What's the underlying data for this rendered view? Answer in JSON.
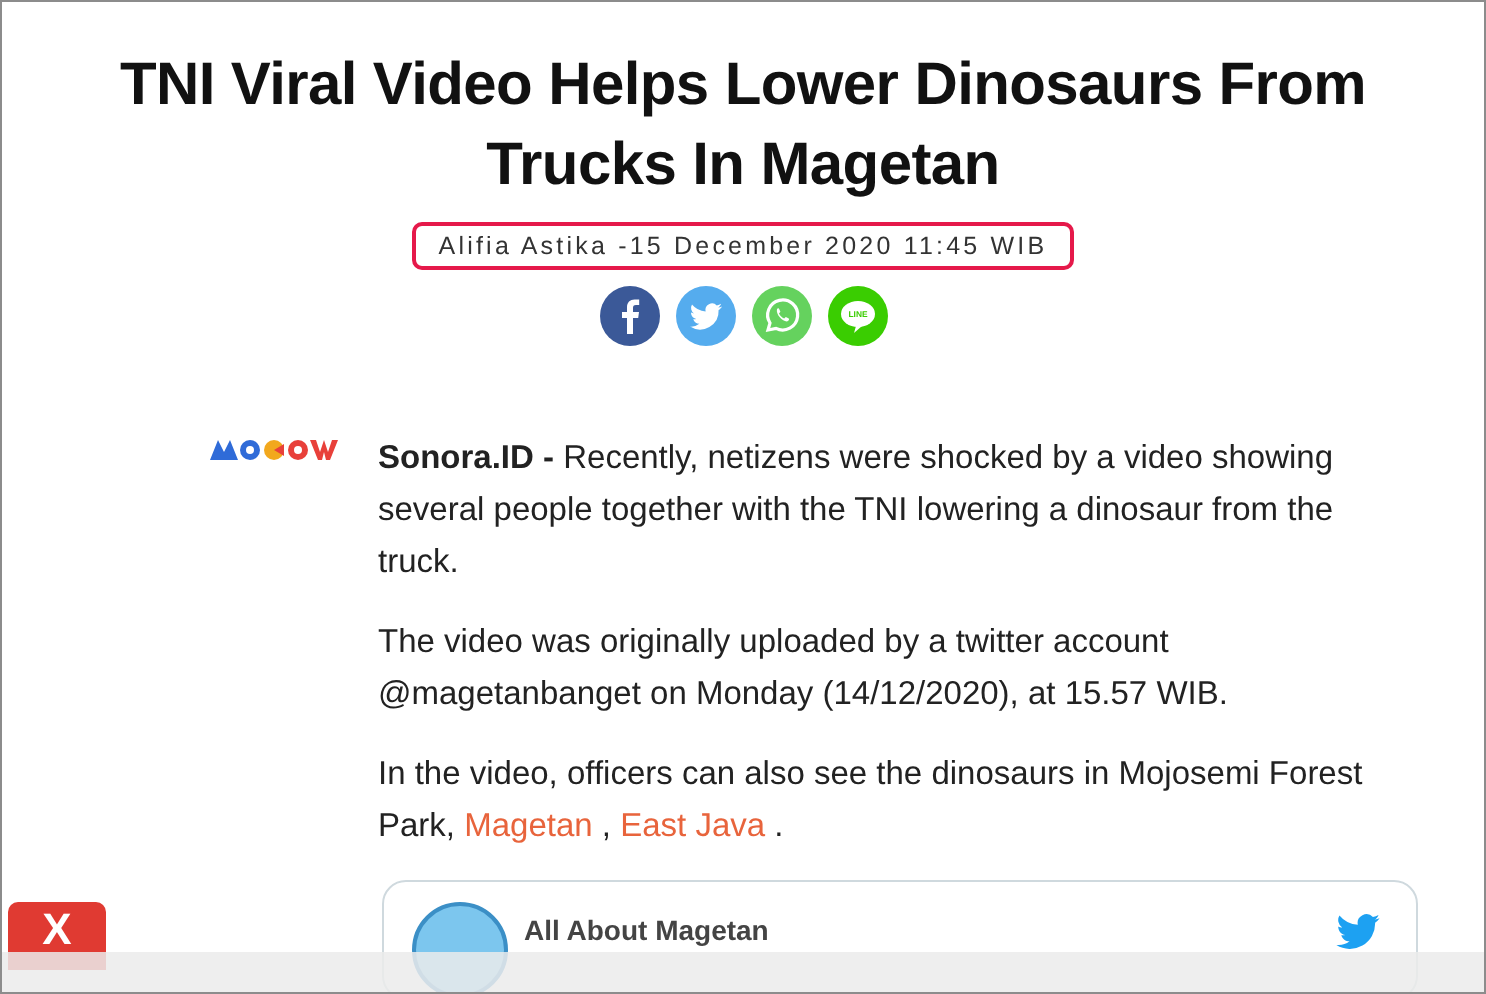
{
  "article": {
    "title": "TNI Viral Video Helps Lower Dinosaurs From Trucks In Magetan",
    "byline": "Alifia Astika -15 December 2020 11:45 WIB",
    "share": [
      {
        "kind": "facebook"
      },
      {
        "kind": "twitter"
      },
      {
        "kind": "whatsapp"
      },
      {
        "kind": "line",
        "label": "LINE"
      }
    ],
    "paragraphs": [
      {
        "parts": [
          {
            "kind": "text",
            "text": "**Sonora.ID -**  Recently, netizens were shocked by a video showing several people together with the TNI lowering a dinosaur from the truck."
          }
        ]
      },
      {
        "parts": [
          {
            "kind": "text",
            "text": "The video was originally uploaded by a twitter account @magetanbanget on Monday (14/12/2020), at 15.57 WIB."
          }
        ]
      },
      {
        "parts": [
          {
            "kind": "text",
            "text": "In the video, officers can also see the dinosaurs in Mojosemi Forest Park, "
          },
          {
            "kind": "link",
            "text": "Magetan"
          },
          {
            "kind": "text",
            "text": " , "
          },
          {
            "kind": "link",
            "text": "East Java"
          },
          {
            "kind": "text",
            "text": " ."
          }
        ]
      }
    ],
    "tweet": {
      "account": "All About Magetan"
    }
  },
  "close_button": {
    "label": "X"
  }
}
